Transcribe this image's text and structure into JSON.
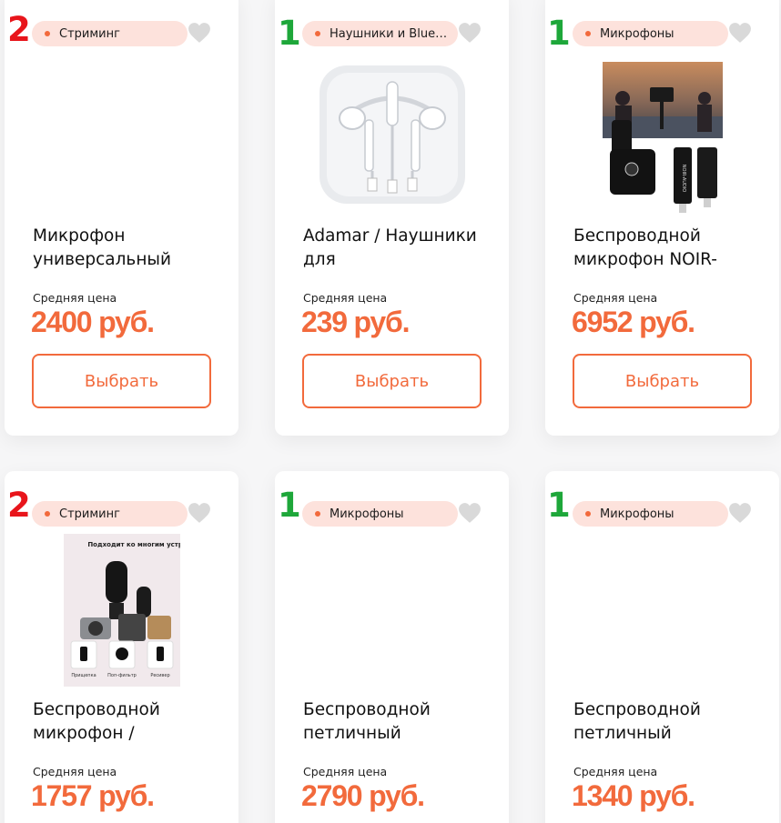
{
  "cards": [
    {
      "rank": "2",
      "rank_color": "#e8151b",
      "tag": "Стриминг",
      "title": "Микрофон универсальный",
      "avg_label": "Средняя цена",
      "price": "2400 руб.",
      "button": "Выбрать",
      "image": "none"
    },
    {
      "rank": "1",
      "rank_color": "#1ea73a",
      "tag": "Наушники и Bluetooth",
      "title": "Adamar / Наушники для",
      "avg_label": "Средняя цена",
      "price": "239 руб.",
      "button": "Выбрать",
      "image": "earphones-photo"
    },
    {
      "rank": "1",
      "rank_color": "#1ea73a",
      "tag": "Микрофоны",
      "title": "Беспроводной микрофон NOIR-",
      "avg_label": "Средняя цена",
      "price": "6952 руб.",
      "button": "Выбрать",
      "image": "wireless-mic-photo",
      "image_text": "NOIR-AUDIO"
    },
    {
      "rank": "2",
      "rank_color": "#e8151b",
      "tag": "Стриминг",
      "title": "Беспроводной микрофон /",
      "avg_label": "Средняя цена",
      "price": "1757 руб.",
      "image": "mic-kit-photo",
      "image_text": "Подходит ко многим устройствам",
      "image_captions": [
        "Прищепка",
        "Поп-фильтр",
        "Ресивер"
      ]
    },
    {
      "rank": "1",
      "rank_color": "#1ea73a",
      "tag": "Микрофоны",
      "title": "Беспроводной петличный",
      "avg_label": "Средняя цена",
      "price": "2790 руб.",
      "image": "none"
    },
    {
      "rank": "1",
      "rank_color": "#1ea73a",
      "tag": "Микрофоны",
      "title": "Беспроводной петличный",
      "avg_label": "Средняя цена",
      "price": "1340 руб.",
      "image": "none"
    }
  ],
  "colors": {
    "accent": "#f26a3c",
    "tag_bg": "#fde2dc",
    "rank_red": "#e8151b",
    "rank_green": "#1ea73a",
    "heart": "#d9d9d9"
  }
}
